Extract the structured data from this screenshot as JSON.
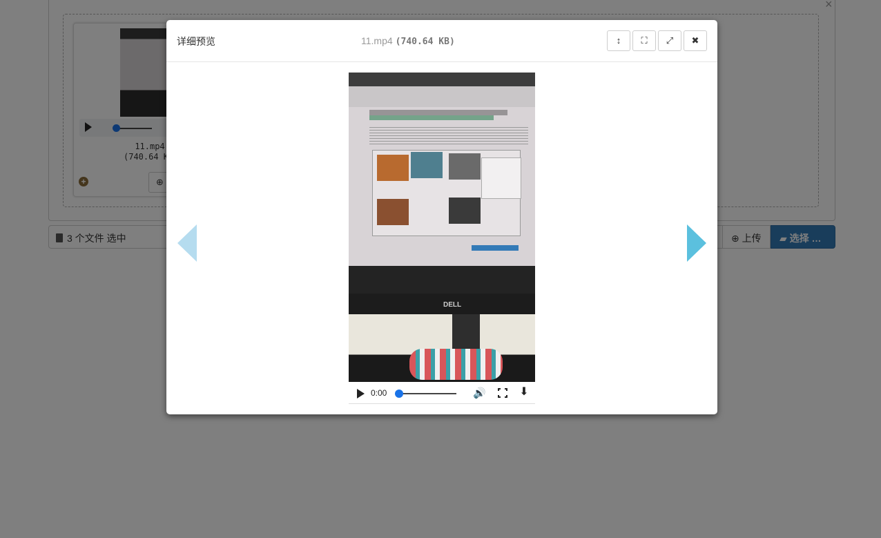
{
  "background": {
    "thumb": {
      "filename": "11.mp4",
      "filesize": "(740.64 K"
    },
    "caption": "3 个文件 选中",
    "upload_label": "上传",
    "select_label": "选择 …",
    "close_glyph": "×",
    "plus_glyph": "+"
  },
  "modal": {
    "title": "详细预览",
    "file_name": "11.mp4",
    "file_size": "(740.64 KB)",
    "buttons": {
      "toggle_height": "↕",
      "zoom": "⛶",
      "fullscreen": "⤢",
      "close": "✖"
    }
  },
  "video": {
    "time": "0:00",
    "progress": 0,
    "screen_logo": "DELL",
    "volume_glyph": "🔊",
    "download_glyph": "⬇"
  },
  "colors": {
    "primary": "#337ab7",
    "nav_arrow": "#5bc0de",
    "progress": "#1a73e8"
  }
}
